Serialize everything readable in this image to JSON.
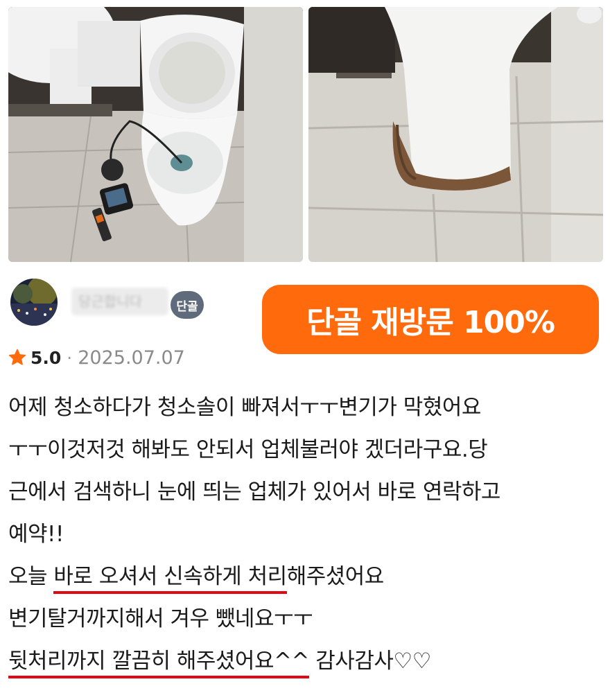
{
  "photos": [
    {
      "name": "toilet-inspection-camera-photo"
    },
    {
      "name": "toilet-base-floor-photo"
    }
  ],
  "reviewer": {
    "nickname": "당근합니다",
    "badge": "단골"
  },
  "promo_badge": "단골 재방문 100%",
  "rating": {
    "score": "5.0",
    "separator": "·",
    "date": "2025.07.07",
    "star_color": "#ff6a0d"
  },
  "review": {
    "line1": "어제 청소하다가 청소솔이 빠져서ㅜㅜ변기가 막혔어요",
    "line2": "ㅜㅜ이것저것 해봐도 안되서 업체불러야 겠더라구요.당",
    "line3": "근에서 검색하니 눈에 띄는 업체가 있어서 바로 연락하고",
    "line4": "예약!!",
    "line5_pre": "오늘 ",
    "line5_ul": "바로 오셔서 신속하게 처리",
    "line5_post": "해주셨어요",
    "line6": "변기탈거까지해서 겨우 뺐네요ㅜㅜ",
    "line7_ul": "뒷처리까지 깔끔히 해주셨어요^^",
    "line7_post": " 감사감사♡♡"
  },
  "colors": {
    "accent": "#ff6a0d",
    "underline": "#e30613",
    "badge_bg": "#5f6b7a"
  }
}
